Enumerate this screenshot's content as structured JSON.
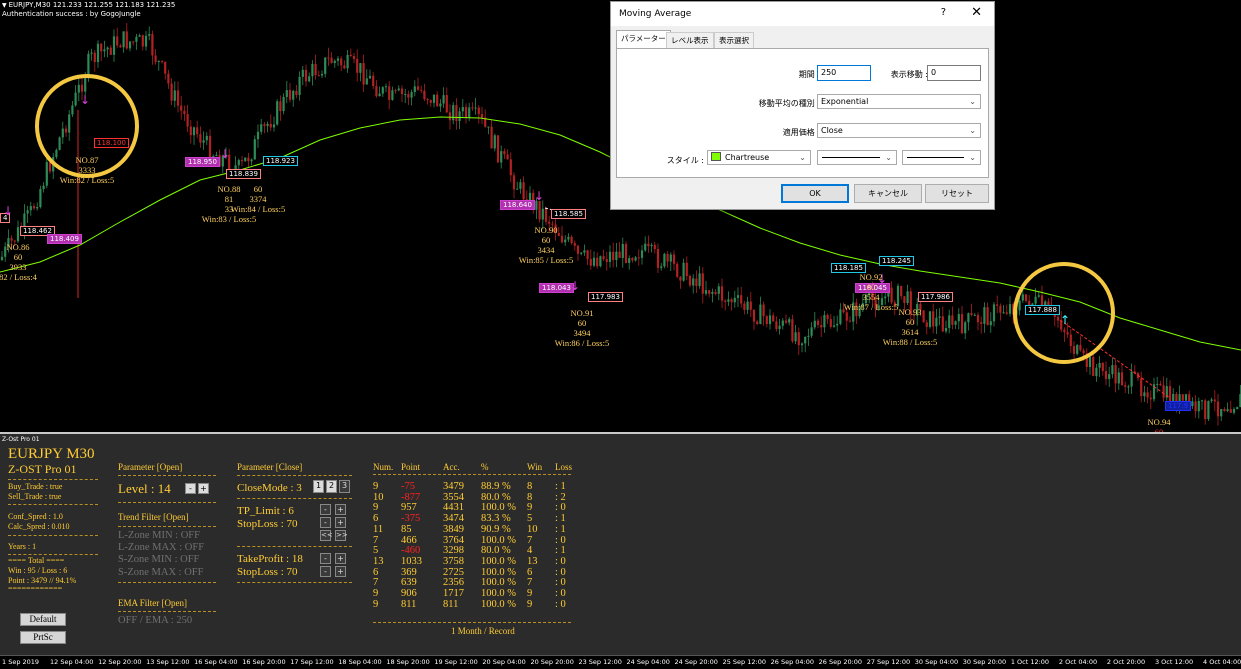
{
  "chart": {
    "symbol_line": "EURJPY,M30  121.233 121.255 121.183 121.235",
    "auth_line": "Authentication success : by GogoJungle",
    "price_tags": [
      "118.462",
      "118.409",
      "118.100",
      "118.950",
      "118.839",
      "118.923",
      "118.640",
      "118.585",
      "118.043",
      "117.983",
      "118.185",
      "118.245",
      "118.045",
      "117.986",
      "117.888",
      "117.9"
    ],
    "trade_labels": [
      {
        "lines": [
          "NO.86",
          "60",
          "3933",
          "82 / Loss:4"
        ]
      },
      {
        "lines": [
          "NO.87",
          "",
          "3333",
          "Win:82 / Loss:5"
        ]
      },
      {
        "lines": [
          "NO.88",
          "81",
          "33",
          "Win:83 / Loss:5"
        ]
      },
      {
        "lines": [
          "60",
          "3374",
          "Win:84 / Loss:5"
        ]
      },
      {
        "lines": [
          "NO.90",
          "60",
          "3434",
          "Win:85 / Loss:5"
        ]
      },
      {
        "lines": [
          "NO.91",
          "60",
          "3494",
          "Win:86 / Loss:5"
        ]
      },
      {
        "lines": [
          "NO.92",
          "60",
          "3554",
          "Win:87 / Loss:5"
        ]
      },
      {
        "lines": [
          "NO.93",
          "60",
          "3614",
          "Win:88 / Loss:5"
        ]
      },
      {
        "lines": [
          "NO.94",
          "60"
        ]
      }
    ],
    "left_edge_tag": "4"
  },
  "panel": {
    "title": "Z-Ost Pro 01",
    "pair": "EURJPY M30",
    "product": "Z-OST Pro 01",
    "buy_trade": "Buy_Trade : true",
    "sell_trade": "Sell_Trade : true",
    "conf_spred": "Conf_Spred : 1.0",
    "calc_spred": "Calc_Spred : 0.010",
    "years": "Years : 1",
    "total_header": "====  Total ====",
    "win_loss": "Win : 95  /  Loss : 6",
    "point": "Point : 3479 // 94.1%",
    "equals": "============",
    "default_btn": "Default",
    "prtsc_btn": "PrtSc",
    "param_open": "Parameter [Open]",
    "level": "Level : 14",
    "trend_filter": "Trend Filter [Open]",
    "lzone_min": "L-Zone MIN  : OFF",
    "lzone_max": "L-Zone MAX : OFF",
    "szone_min": "S-Zone MIN  : OFF",
    "szone_max": "S-Zone MAX : OFF",
    "ema_filter": "EMA Filter [Open]",
    "ema_value": "OFF   /   EMA : 250",
    "param_close": "Parameter [Close]",
    "close_mode": "CloseMode : 3",
    "close_modes": [
      "1",
      "2",
      "3"
    ],
    "tp_limit": "TP_Limit : 6",
    "stoploss_1": "StopLoss : 70",
    "take_profit": "TakeProfit : 18",
    "stoploss_2": "StopLoss : 70",
    "minus": "-",
    "plus": "+",
    "rewind": "<<",
    "forward": ">>",
    "record_headers": [
      "Num.",
      "Point",
      "Acc.",
      "%",
      "Win",
      "Loss"
    ],
    "records": [
      [
        "9",
        "-75",
        "3479",
        "88.9  %",
        "8",
        ": 1"
      ],
      [
        "10",
        "-877",
        "3554",
        "80.0  %",
        "8",
        ": 2"
      ],
      [
        "9",
        "957",
        "4431",
        "100.0  %",
        "9",
        ": 0"
      ],
      [
        "6",
        "-375",
        "3474",
        "83.3  %",
        "5",
        ": 1"
      ],
      [
        "11",
        "85",
        "3849",
        "90.9  %",
        "10",
        ": 1"
      ],
      [
        "7",
        "466",
        "3764",
        "100.0  %",
        "7",
        ": 0"
      ],
      [
        "5",
        "-460",
        "3298",
        "80.0  %",
        "4",
        ": 1"
      ],
      [
        "13",
        "1033",
        "3758",
        "100.0  %",
        "13",
        ": 0"
      ],
      [
        "6",
        "369",
        "2725",
        "100.0  %",
        "6",
        ": 0"
      ],
      [
        "7",
        "639",
        "2356",
        "100.0  %",
        "7",
        ": 0"
      ],
      [
        "9",
        "906",
        "1717",
        "100.0  %",
        "9",
        ": 0"
      ],
      [
        "9",
        "811",
        "811",
        "100.0  %",
        "9",
        ": 0"
      ]
    ],
    "record_footer": "1 Month / Record"
  },
  "axis": {
    "ticks": [
      "1 Sep 2019",
      "12 Sep 04:00",
      "12 Sep 20:00",
      "13 Sep 12:00",
      "16 Sep 04:00",
      "16 Sep 20:00",
      "17 Sep 12:00",
      "18 Sep 04:00",
      "18 Sep 20:00",
      "19 Sep 12:00",
      "20 Sep 04:00",
      "20 Sep 20:00",
      "23 Sep 12:00",
      "24 Sep 04:00",
      "24 Sep 20:00",
      "25 Sep 12:00",
      "26 Sep 04:00",
      "26 Sep 20:00",
      "27 Sep 12:00",
      "30 Sep 04:00",
      "30 Sep 20:00",
      "1 Oct 12:00",
      "2 Oct 04:00",
      "2 Oct 20:00",
      "3 Oct 12:00",
      "4 Oct 04:00"
    ]
  },
  "dialog": {
    "title": "Moving Average",
    "help": "?",
    "close": "✕",
    "tabs": [
      "パラメーター",
      "レベル表示",
      "表示選択"
    ],
    "period_label": "期間 :",
    "period_value": "250",
    "shift_label": "表示移動 :",
    "shift_value": "0",
    "method_label": "移動平均の種別 :",
    "method_value": "Exponential",
    "apply_label": "適用価格 :",
    "apply_value": "Close",
    "style_label": "スタイル :",
    "color_value": "Chartreuse",
    "ok": "OK",
    "cancel": "キャンセル",
    "reset": "リセット"
  },
  "colors": {
    "ma_line": "#7fff00",
    "bull_candle": "#2e8b57",
    "bear_candle": "#b22222",
    "highlight_ring": "#f5c842",
    "panel_text": "#ffcc33"
  }
}
